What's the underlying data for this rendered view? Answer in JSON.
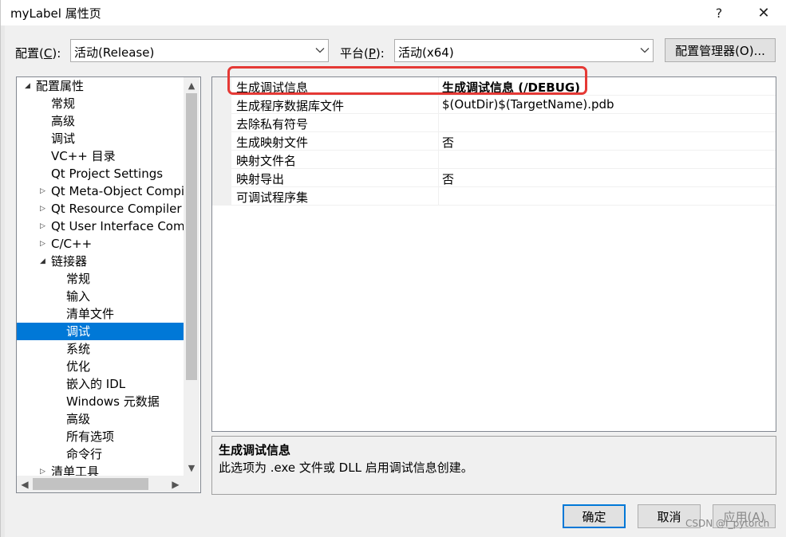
{
  "window": {
    "title": "myLabel 属性页",
    "help_label": "?",
    "close_label": "✕"
  },
  "config": {
    "config_label_prefix": "配置(",
    "config_label_key": "C",
    "config_label_suffix": "):",
    "config_value": "活动(Release)",
    "platform_label_prefix": "平台(",
    "platform_label_key": "P",
    "platform_label_suffix": "):",
    "platform_value": "活动(x64)",
    "manager_button": "配置管理器(O)..."
  },
  "tree": {
    "items": [
      {
        "label": "配置属性",
        "level": 0,
        "expander": "expanded"
      },
      {
        "label": "常规",
        "level": 1,
        "expander": "none"
      },
      {
        "label": "高级",
        "level": 1,
        "expander": "none"
      },
      {
        "label": "调试",
        "level": 1,
        "expander": "none"
      },
      {
        "label": "VC++ 目录",
        "level": 1,
        "expander": "none"
      },
      {
        "label": "Qt Project Settings",
        "level": 1,
        "expander": "none"
      },
      {
        "label": "Qt Meta-Object Compi",
        "level": 1,
        "expander": "collapsed"
      },
      {
        "label": "Qt Resource Compiler",
        "level": 1,
        "expander": "collapsed"
      },
      {
        "label": "Qt User Interface Comp",
        "level": 1,
        "expander": "collapsed"
      },
      {
        "label": "C/C++",
        "level": 1,
        "expander": "collapsed"
      },
      {
        "label": "链接器",
        "level": 1,
        "expander": "expanded"
      },
      {
        "label": "常规",
        "level": 2,
        "expander": "none"
      },
      {
        "label": "输入",
        "level": 2,
        "expander": "none"
      },
      {
        "label": "清单文件",
        "level": 2,
        "expander": "none"
      },
      {
        "label": "调试",
        "level": 2,
        "expander": "none",
        "selected": true
      },
      {
        "label": "系统",
        "level": 2,
        "expander": "none"
      },
      {
        "label": "优化",
        "level": 2,
        "expander": "none"
      },
      {
        "label": "嵌入的 IDL",
        "level": 2,
        "expander": "none"
      },
      {
        "label": "Windows 元数据",
        "level": 2,
        "expander": "none"
      },
      {
        "label": "高级",
        "level": 2,
        "expander": "none"
      },
      {
        "label": "所有选项",
        "level": 2,
        "expander": "none"
      },
      {
        "label": "命令行",
        "level": 2,
        "expander": "none"
      },
      {
        "label": "清单工具",
        "level": 1,
        "expander": "collapsed"
      }
    ]
  },
  "grid": {
    "rows": [
      {
        "name": "生成调试信息",
        "value": "生成调试信息 (/DEBUG)",
        "bold": true
      },
      {
        "name": "生成程序数据库文件",
        "value": "$(OutDir)$(TargetName).pdb",
        "bold": false
      },
      {
        "name": "去除私有符号",
        "value": "",
        "bold": false
      },
      {
        "name": "生成映射文件",
        "value": "否",
        "bold": false
      },
      {
        "name": "映射文件名",
        "value": "",
        "bold": false
      },
      {
        "name": "映射导出",
        "value": "否",
        "bold": false
      },
      {
        "name": "可调试程序集",
        "value": "",
        "bold": false
      }
    ]
  },
  "description": {
    "title": "生成调试信息",
    "text": "此选项为 .exe 文件或 DLL 启用调试信息创建。"
  },
  "buttons": {
    "ok": "确定",
    "cancel": "取消",
    "apply": "应用(A)"
  },
  "watermark": "CSDN @I_pytorch",
  "colors": {
    "selection": "#0078d7",
    "highlight_box": "#e53935"
  }
}
